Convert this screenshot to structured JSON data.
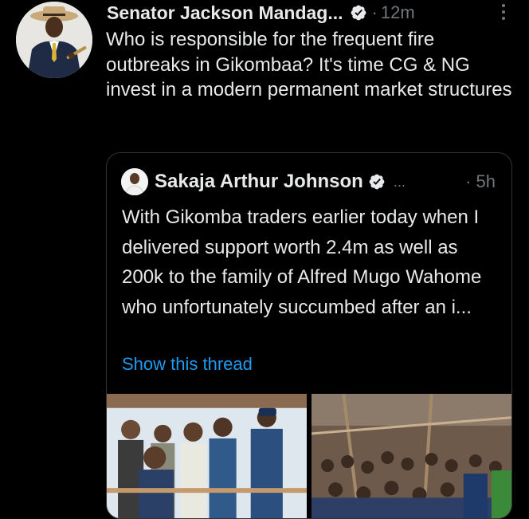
{
  "tweet": {
    "author_name": "Senator Jackson Mandag...",
    "separator": "·",
    "time": "12m",
    "more_icon": "more-vertical-icon",
    "text": "Who is responsible for the frequent fire outbreaks in Gikombaa? It's time CG & NG invest in a modern permanent market structures"
  },
  "quoted_tweet": {
    "author_name": "Sakaja Arthur Johnson",
    "ellipsis": "...",
    "separator": "·",
    "time": "5h",
    "text": "With Gikomba traders earlier today when I delivered support worth 2.4m as well as 200k to the family of Alfred Mugo Wahome who unfortunately succumbed after an i...",
    "link_text": "Show this thread"
  },
  "colors": {
    "background": "#000000",
    "text": "#e7e9ea",
    "muted": "#71767b",
    "link": "#1d9bf0",
    "verified": "#e7e9ea"
  }
}
